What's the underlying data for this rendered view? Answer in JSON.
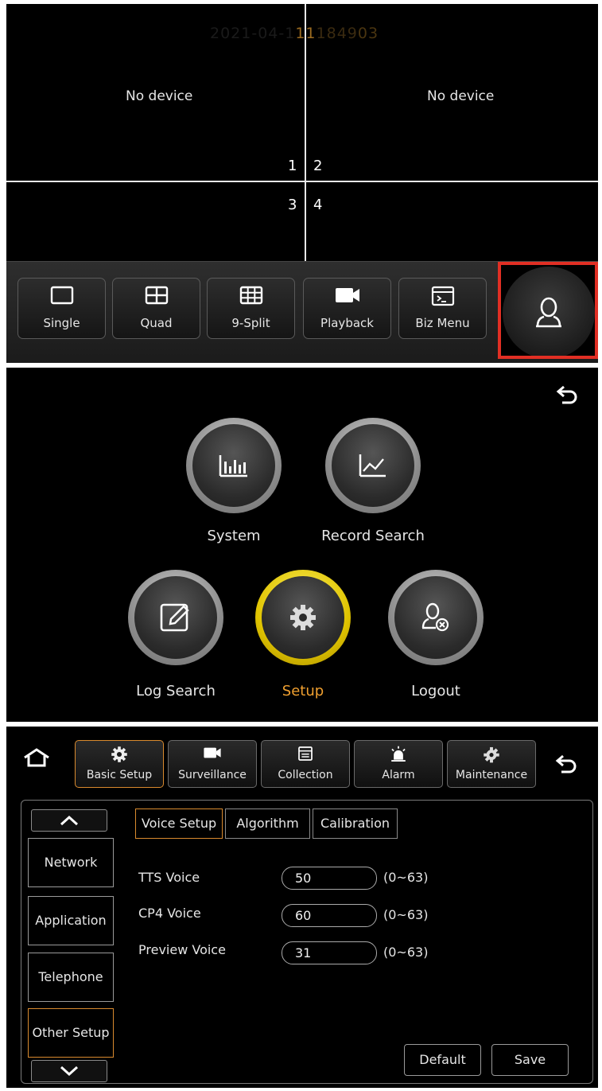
{
  "live_view": {
    "clock": {
      "faint": "2021-04-1",
      "bold": "11",
      "mid": "1849",
      "tail": "03"
    },
    "channels": [
      {
        "status": "No device",
        "number": "1"
      },
      {
        "status": "No device",
        "number": "2"
      },
      {
        "status": "",
        "number": "3"
      },
      {
        "status": "",
        "number": "4"
      }
    ],
    "toolbar": [
      {
        "label": "Single",
        "icon": "single-view-icon"
      },
      {
        "label": "Quad",
        "icon": "quad-view-icon"
      },
      {
        "label": "9-Split",
        "icon": "nine-split-icon"
      },
      {
        "label": "Playback",
        "icon": "video-camera-icon"
      },
      {
        "label": "Biz Menu",
        "icon": "terminal-window-icon"
      }
    ],
    "user_button": {
      "icon": "user-icon",
      "highlight_color": "#e12f24"
    }
  },
  "main_menu": {
    "items": [
      {
        "label": "System",
        "icon": "bar-chart-icon"
      },
      {
        "label": "Record Search",
        "icon": "line-chart-icon"
      },
      {
        "label": "Log Search",
        "icon": "edit-log-icon"
      },
      {
        "label": "Setup",
        "icon": "gear-icon",
        "selected": true
      },
      {
        "label": "Logout",
        "icon": "logout-user-icon"
      }
    ],
    "selected_color": "#f0a030"
  },
  "setup": {
    "tabs": [
      {
        "label": "Basic Setup",
        "icon": "gear-icon",
        "selected": true
      },
      {
        "label": "Surveillance",
        "icon": "camera-icon"
      },
      {
        "label": "Collection",
        "icon": "document-icon"
      },
      {
        "label": "Alarm",
        "icon": "alarm-siren-icon"
      },
      {
        "label": "Maintenance",
        "icon": "maintenance-gear-icon"
      }
    ],
    "side_menu": [
      {
        "label": "Network"
      },
      {
        "label": "Application"
      },
      {
        "label": "Telephone"
      },
      {
        "label": "Other Setup",
        "selected": true
      }
    ],
    "sub_tabs": [
      {
        "label": "Voice Setup",
        "selected": true
      },
      {
        "label": "Algorithm"
      },
      {
        "label": "Calibration"
      }
    ],
    "fields": [
      {
        "label": "TTS Voice",
        "value": "50",
        "range": "(0~63)"
      },
      {
        "label": "CP4 Voice",
        "value": "60",
        "range": "(0~63)"
      },
      {
        "label": "Preview Voice",
        "value": "31",
        "range": "(0~63)"
      }
    ],
    "actions": {
      "default_label": "Default",
      "save_label": "Save"
    },
    "accent_color": "#d98a2e"
  }
}
